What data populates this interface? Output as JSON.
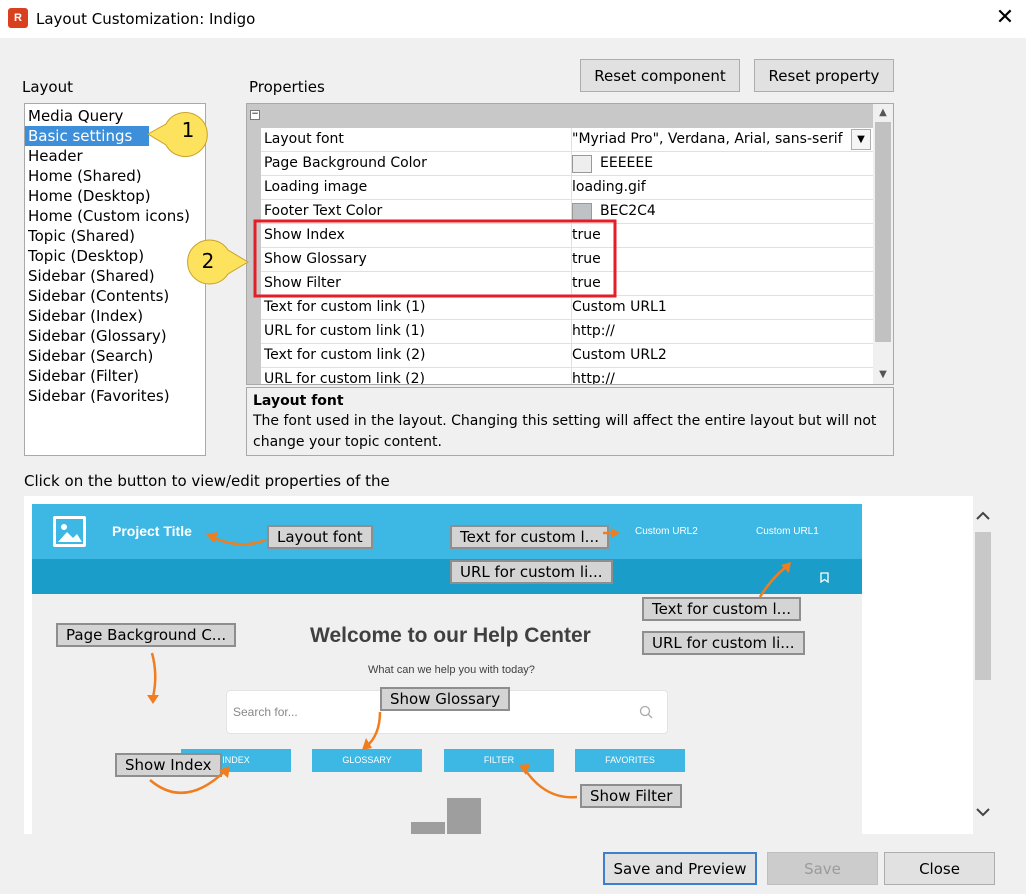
{
  "window": {
    "title": "Layout Customization: Indigo",
    "app_icon": "robohelp-icon",
    "close_glyph": "✕"
  },
  "layout_panel": {
    "label": "Layout",
    "items": [
      "Media Query",
      "Basic settings",
      "Header",
      "Home (Shared)",
      "Home (Desktop)",
      "Home (Custom icons)",
      "Topic (Shared)",
      "Topic (Desktop)",
      "Sidebar (Shared)",
      "Sidebar (Contents)",
      "Sidebar (Index)",
      "Sidebar (Glossary)",
      "Sidebar (Search)",
      "Sidebar (Filter)",
      "Sidebar (Favorites)"
    ],
    "selected": "Basic settings"
  },
  "properties_panel": {
    "label": "Properties",
    "reset_component": "Reset component",
    "reset_property": "Reset property",
    "collapse_glyph": "−",
    "rows": [
      {
        "name": "Layout font",
        "value": "\"Myriad Pro\", Verdana, Arial, sans-serif"
      },
      {
        "name": "Page Background Color",
        "value": "EEEEEE",
        "swatch": "#eeeeee"
      },
      {
        "name": "Loading image",
        "value": "loading.gif"
      },
      {
        "name": "Footer Text Color",
        "value": "BEC2C4",
        "swatch": "#bec2c4"
      },
      {
        "name": "Show Index",
        "value": "true"
      },
      {
        "name": "Show Glossary",
        "value": "true"
      },
      {
        "name": "Show Filter",
        "value": "true"
      },
      {
        "name": "Text for custom link (1)",
        "value": "Custom URL1"
      },
      {
        "name": "URL for custom link (1)",
        "value": "http://"
      },
      {
        "name": "Text for custom link (2)",
        "value": "Custom URL2"
      },
      {
        "name": "URL for custom link (2)",
        "value": "http://"
      }
    ]
  },
  "description": {
    "title": "Layout font",
    "text": "The font used in the layout. Changing this setting will affect the entire layout but will not change your topic content."
  },
  "hint": "Click on the button to view/edit properties of the",
  "preview": {
    "project_title": "Project Title",
    "custom_url2": "Custom URL2",
    "custom_url1": "Custom URL1",
    "welcome": "Welcome to our Help Center",
    "subtitle": "What can we help you with today?",
    "search_placeholder": "Search for...",
    "buttons": [
      "INDEX",
      "GLOSSARY",
      "FILTER",
      "FAVORITES"
    ],
    "tags": {
      "layout_font": "Layout font",
      "text_custom_top": "Text for custom l...",
      "url_custom_top": "URL for custom li...",
      "text_custom_right": "Text for custom l...",
      "url_custom_right": "URL for custom li...",
      "page_bg": "Page Background C...",
      "show_glossary": "Show Glossary",
      "show_index": "Show Index",
      "show_filter": "Show Filter"
    }
  },
  "callouts": {
    "one": "1",
    "two": "2"
  },
  "footer": {
    "save_preview": "Save and Preview",
    "save": "Save",
    "close": "Close"
  },
  "colors": {
    "accent": "#3c8fd8",
    "preview_header": "#3db7e4",
    "preview_nav": "#1a9ec9",
    "highlight": "#e41e26",
    "arrow": "#f07d1e",
    "callout": "#fde25d"
  }
}
